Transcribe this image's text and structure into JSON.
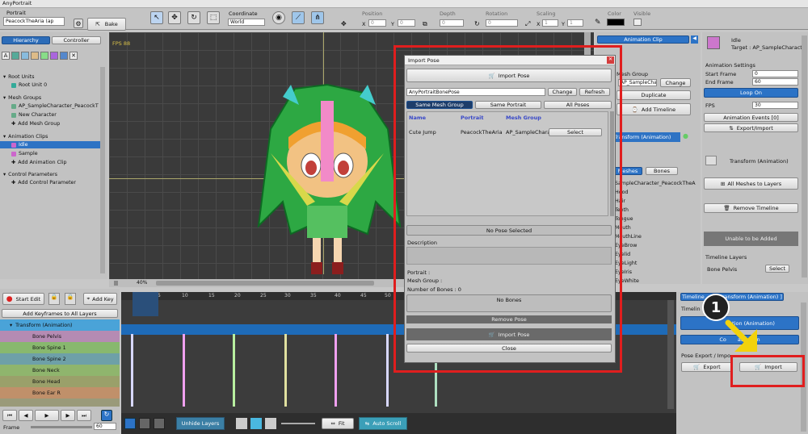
{
  "app": {
    "title": "AnyPortrait"
  },
  "toolbar": {
    "portrait_label": "Portrait",
    "portrait_value": "PeacockTheAria (ap",
    "bake": "Bake",
    "coordinate_label": "Coordinate",
    "coordinate_value": "World",
    "position": "Position",
    "pos_x": "X",
    "pos_x_val": "0",
    "pos_y": "Y",
    "pos_y_val": "0",
    "depth": "Depth",
    "depth_val": "0",
    "rotation": "Rotation",
    "rotation_val": "0",
    "scaling": "Scaling",
    "scale_x": "X",
    "scale_x_val": "1",
    "scale_y": "Y",
    "scale_y_val": "1",
    "color": "Color",
    "visible": "Visible"
  },
  "hierarchy": {
    "tab_hierarchy": "Hierarchy",
    "tab_controller": "Controller",
    "root_units": "Root Units",
    "root_unit_0": "Root Unit 0",
    "mesh_groups": "Mesh Groups",
    "mesh_group_1": "AP_SampleCharacter_PeacockT",
    "mesh_group_2": "New Character",
    "add_mesh_group": "Add Mesh Group",
    "animation_clips": "Animation Clips",
    "clip_idle": "Idle",
    "clip_sample": "Sample",
    "add_animation_clip": "Add Animation Clip",
    "control_parameters": "Control Parameters",
    "add_control_parameter": "Add Control Parameter"
  },
  "viewport": {
    "fps": "FPS 88",
    "zoom": "40%"
  },
  "anim_clip_panel": {
    "header": "Animation Clip",
    "mesh_group": "Mesh Group",
    "field": "AP_SampleCharact",
    "change": "Change",
    "duplicate": "Duplicate",
    "add_timeline": "Add Timeline",
    "transform_anim": "Transform (Animation)",
    "tab_meshes": "Meshes",
    "tab_bones": "Bones",
    "root": "SampleCharacter_PeacockTheA",
    "items": [
      "Hood",
      "Hair",
      "Teeth",
      "Tongue",
      "Mouth",
      "MouthLine",
      "EyeBrow",
      "Eyelid",
      "EyeLight",
      "EyeIris",
      "EyeWhite"
    ]
  },
  "props": {
    "name": "Idle",
    "target": "Target : AP_SampleCharact",
    "settings": "Animation Settings",
    "start_frame": "Start Frame",
    "start_val": "0",
    "end_frame": "End Frame",
    "end_val": "60",
    "loop_on": "Loop On",
    "fps": "FPS",
    "fps_val": "30",
    "anim_events": "Animation Events [0]",
    "export_import": "Export/Import",
    "transform_anim": "Transform (Animation)",
    "all_meshes": "All Meshes to Layers",
    "remove_timeline": "Remove Timeline",
    "unable": "Unable to be Added",
    "timeline_layers": "Timeline Layers",
    "bone_pelvis": "Bone Pelvis",
    "select": "Select",
    "tl_header": "Timeline",
    "tl_header_rest": "ransform (Animation) ]",
    "timeline_label": "Timelin",
    "anim_btn": "tion (Animation)",
    "con_btn": "Co",
    "con_btn_rest": "ation On",
    "pose_export": "Pose Export / Impo",
    "export": "Export",
    "import": "Import",
    "step": "1"
  },
  "timeline": {
    "start_edit": "Start Edit",
    "add_key": "Add Key",
    "add_keyframes_all": "Add Keyframes to All Layers",
    "layers": [
      {
        "name": "Transform (Animation)",
        "color": "#4aa3d8"
      },
      {
        "name": "Bone Pelvis",
        "color": "#b58bb3"
      },
      {
        "name": "Bone Spine 1",
        "color": "#88b86e"
      },
      {
        "name": "Bone Spine 2",
        "color": "#6ea0a8"
      },
      {
        "name": "Bone Neck",
        "color": "#8fb56d"
      },
      {
        "name": "Bone Head",
        "color": "#9aa06a"
      },
      {
        "name": "Bone Ear R",
        "color": "#c0906a"
      }
    ],
    "ticks": [
      "0",
      "5",
      "10",
      "15",
      "20",
      "25",
      "30",
      "35",
      "40",
      "45",
      "50",
      "55"
    ],
    "frame_label": "Frame",
    "frame_val": "60",
    "unhide_layers": "Unhide Layers",
    "fit": "Fit",
    "auto_scroll": "Auto Scroll"
  },
  "dialog": {
    "title": "Import Pose",
    "import_pose": "Import Pose",
    "file": "AnyPortraitBonePose",
    "change": "Change",
    "refresh": "Refresh",
    "tab_same_mesh": "Same Mesh Group",
    "tab_same_portrait": "Same Portrait",
    "tab_all": "All Poses",
    "col_name": "Name",
    "col_portrait": "Portrait",
    "col_mesh": "Mesh Group",
    "row_name": "Cute Jump",
    "row_portrait": "PeacockTheAria",
    "row_mesh": "AP_SampleCharac",
    "row_select": "Select",
    "no_pose": "No Pose Selected",
    "description": "Description",
    "portrait": "Portrait :",
    "mesh_group": "Mesh Group :",
    "bones": "Number of Bones : 0",
    "no_bones": "No Bones",
    "remove_pose": "Remove Pose",
    "import_pose_btn": "Import Pose",
    "close": "Close"
  },
  "colors": {
    "accent": "#2c73c6",
    "highlight": "#e01e1e",
    "selection": "#1e6bb8"
  }
}
